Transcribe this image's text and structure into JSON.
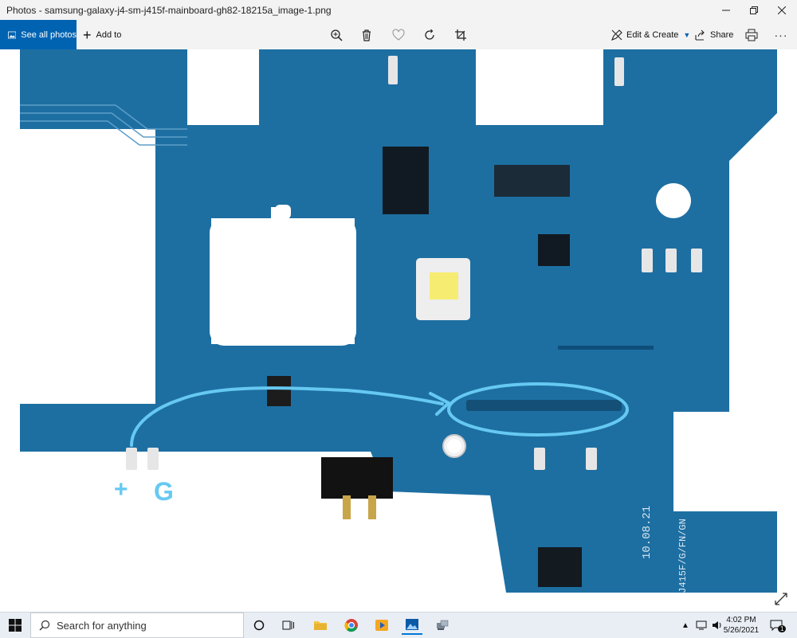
{
  "window": {
    "title": "Photos - samsung-galaxy-j4-sm-j415f-mainboard-gh82-18215a_image-1.png"
  },
  "toolbar": {
    "see_all": "See all photos",
    "add_to": "Add to",
    "edit_create": "Edit & Create",
    "share": "Share"
  },
  "photo": {
    "board_text": "10.08.21",
    "board_text2": "-J415F/G/FN/GN",
    "annotation_plus": "+",
    "annotation_g": "G"
  },
  "taskbar": {
    "search_placeholder": "Search for anything",
    "time": "4:02 PM",
    "date": "5/26/2021",
    "notification_count": "1"
  },
  "colors": {
    "accent": "#0063b1",
    "board": "#1d6fa2",
    "annotation": "#66c9f2"
  }
}
